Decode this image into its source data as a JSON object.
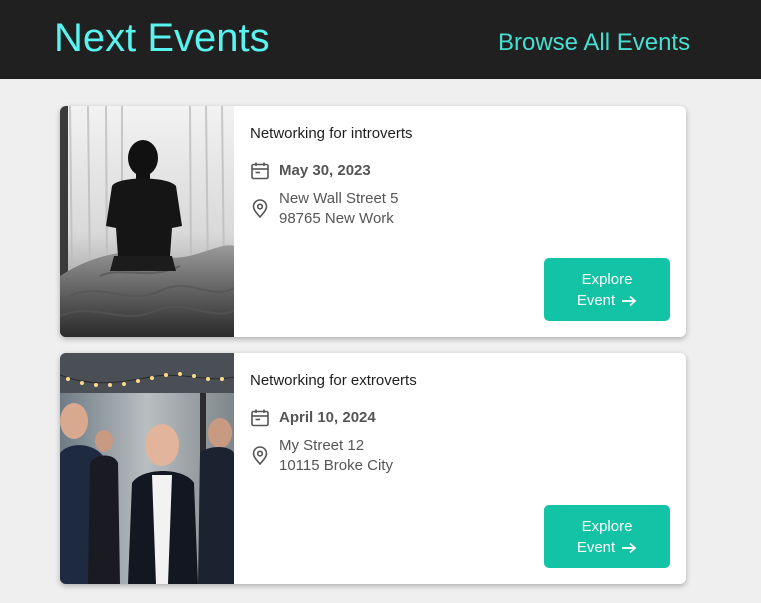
{
  "header": {
    "title": "Next Events",
    "browse_link": "Browse All Events"
  },
  "colors": {
    "header_bg": "#202020",
    "title_accent": "#59f3f0",
    "link_accent": "#46dfd2",
    "button_bg": "#12c3a5"
  },
  "events": [
    {
      "title": "Networking for introverts",
      "date": "May 30, 2023",
      "address_line1": "New Wall Street 5",
      "address_line2": "98765 New Work",
      "button_line1": "Explore",
      "button_line2": "Event",
      "image_icon": "person-sitting-photo"
    },
    {
      "title": "Networking for extroverts",
      "date": "April 10, 2024",
      "address_line1": "My Street 12",
      "address_line2": "10115 Broke City",
      "button_line1": "Explore",
      "button_line2": "Event",
      "image_icon": "people-networking-photo"
    }
  ],
  "icons": {
    "date": "calendar-icon",
    "location": "map-pin-icon",
    "button": "arrow-right-icon"
  }
}
